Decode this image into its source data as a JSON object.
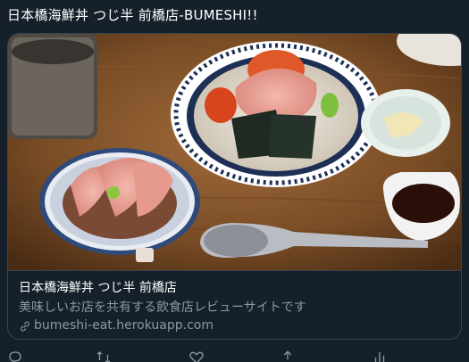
{
  "tweet": {
    "text": "日本橋海鮮丼 つじ半 前橋店-BUMESHI!!"
  },
  "card": {
    "title": "日本橋海鮮丼 つじ半 前橋店",
    "description": "美味しいお店を共有する飲食店レビューサイトです",
    "domain": "bumeshi-eat.herokuapp.com",
    "image_alt_icon": "food-photo"
  },
  "actions": {
    "icons": [
      "reply-icon",
      "retweet-icon",
      "like-icon",
      "share-icon",
      "analytics-icon"
    ]
  },
  "colors": {
    "background": "#15202b",
    "border": "#38444d",
    "secondary_text": "#8899a6",
    "primary_text": "#ffffff"
  }
}
